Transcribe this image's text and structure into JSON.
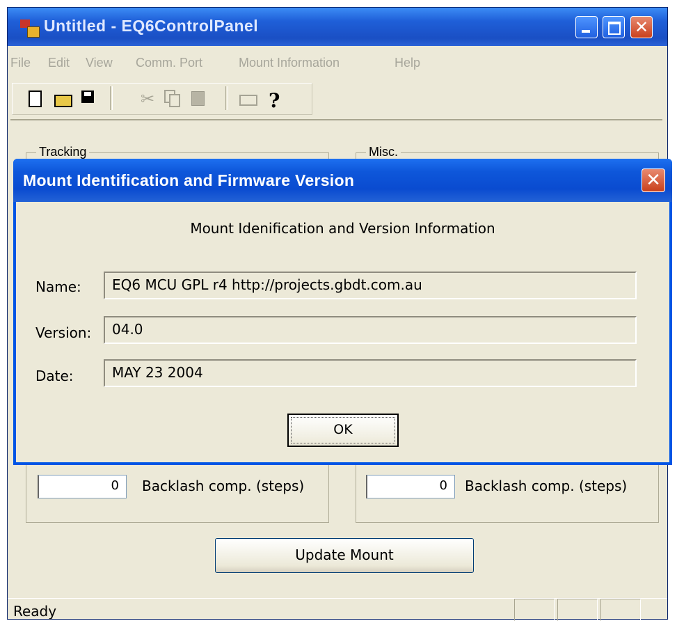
{
  "window": {
    "title": "Untitled - EQ6ControlPanel",
    "controls": {
      "minimize_icon": "minimize-icon",
      "maximize_icon": "maximize-icon",
      "close_icon": "close-icon",
      "close_glyph": "✕"
    }
  },
  "menubar": {
    "items": [
      "File",
      "Edit",
      "View",
      "Comm. Port",
      "Mount Information",
      "Help"
    ]
  },
  "toolbar": {
    "icons": [
      "new-file-icon",
      "open-folder-icon",
      "save-icon",
      "cut-icon",
      "copy-icon",
      "paste-icon",
      "print-icon",
      "help-icon"
    ],
    "cut_glyph": "✂",
    "help_glyph": "?"
  },
  "groups": {
    "tracking": {
      "label": "Tracking",
      "backlash_value": "0",
      "backlash_label": "Backlash comp. (steps)"
    },
    "misc": {
      "label": "Misc.",
      "backlash_value": "0",
      "backlash_label": "Backlash comp. (steps)"
    }
  },
  "update_button": "Update Mount",
  "statusbar": {
    "text": "Ready"
  },
  "dialog": {
    "title": "Mount Identification and Firmware Version",
    "close_glyph": "✕",
    "heading": "Mount Idenification and Version Information",
    "fields": [
      {
        "label": "Name:",
        "value": "EQ6 MCU GPL r4 http://projects.gbdt.com.au"
      },
      {
        "label": "Version:",
        "value": "04.0"
      },
      {
        "label": "Date:",
        "value": "MAY 23 2004"
      }
    ],
    "ok": "OK"
  },
  "colors": {
    "titlebar": "#1f5fd8",
    "dialog_border": "#0055e5",
    "face": "#ece9d8",
    "close": "#c9401c"
  }
}
